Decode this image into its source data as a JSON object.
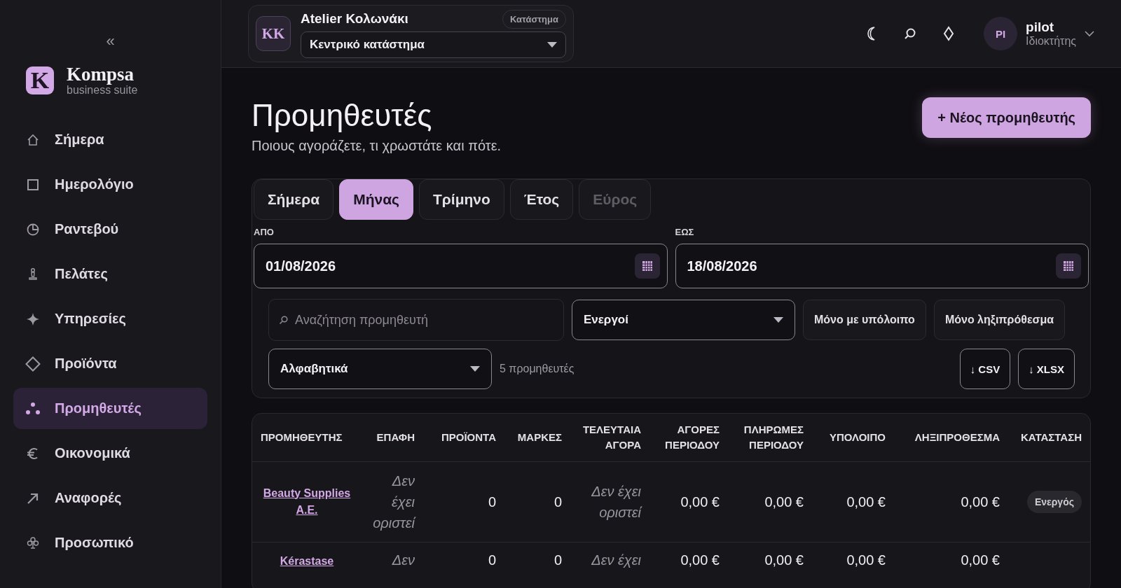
{
  "sidebar": {
    "collapse": "«",
    "brand": {
      "logo": "K",
      "name": "Kompsa",
      "tagline": "business suite"
    },
    "items": [
      {
        "label": "Σήμερα",
        "kind": "home",
        "selected": false
      },
      {
        "label": "Ημερολόγιο",
        "kind": "calendar",
        "selected": false
      },
      {
        "label": "Ραντεβού",
        "kind": "appointments",
        "selected": false
      },
      {
        "label": "Πελάτες",
        "kind": "clients",
        "selected": false
      },
      {
        "label": "Υπηρεσίες",
        "kind": "services",
        "selected": false
      },
      {
        "label": "Προϊόντα",
        "kind": "products",
        "selected": false
      },
      {
        "label": "Προμηθευτές",
        "kind": "suppliers",
        "selected": true
      },
      {
        "label": "Οικονομικά",
        "kind": "finance",
        "selected": false
      },
      {
        "label": "Αναφορές",
        "kind": "reports",
        "selected": false
      },
      {
        "label": "Προσωπικό",
        "kind": "staff",
        "selected": false
      }
    ]
  },
  "topbar": {
    "store": {
      "initials": "KK",
      "name": "Atelier Κολωνάκι",
      "badge": "Κατάστημα",
      "branch": "Κεντρικό κατάστημα"
    },
    "user": {
      "initials": "PI",
      "name": "pilot",
      "role": "Ιδιοκτήτης"
    }
  },
  "page": {
    "title": "Προμηθευτές",
    "subtitle": "Ποιους αγοράζετε, τι χρωστάτε και πότε.",
    "new_button": "+ Νέος προμηθευτής"
  },
  "filters": {
    "tabs": [
      {
        "label": "Σήμερα",
        "selected": false,
        "disabled": false
      },
      {
        "label": "Μήνας",
        "selected": true,
        "disabled": false
      },
      {
        "label": "Τρίμηνο",
        "selected": false,
        "disabled": false
      },
      {
        "label": "Έτος",
        "selected": false,
        "disabled": false
      },
      {
        "label": "Εύρος",
        "selected": false,
        "disabled": true
      }
    ],
    "from": {
      "label": "ΑΠΟ",
      "value": "01/08/2026"
    },
    "to": {
      "label": "ΕΩΣ",
      "value": "18/08/2026"
    },
    "search": {
      "placeholder": "Αναζήτηση προμηθευτή"
    },
    "status_select": "Ενεργοί",
    "toggles": [
      {
        "label": "Μόνο με υπόλοιπο",
        "on": false
      },
      {
        "label": "Μόνο ληξιπρόθεσμα",
        "on": false
      }
    ],
    "sort_select": "Αλφαβητικά",
    "count": "5 προμηθευτές",
    "exports": [
      "↓ CSV",
      "↓ XLSX"
    ]
  },
  "table": {
    "columns": [
      "ΠΡΟΜΗΘΕΥΤΗΣ",
      "ΕΠΑΦΗ",
      "ΠΡΟΪΟΝΤΑ",
      "ΜΑΡΚΕΣ",
      "ΤΕΛΕΥΤΑΙΑ ΑΓΟΡΑ",
      "ΑΓΟΡΕΣ ΠΕΡΙΟΔΟΥ",
      "ΠΛΗΡΩΜΕΣ ΠΕΡΙΟΔΟΥ",
      "ΥΠΟΛΟΙΠΟ",
      "ΛΗΞΙΠΡΟΘΕΣΜΑ",
      "ΚΑΤΑΣΤΑΣΗ"
    ],
    "rows": [
      {
        "supplier": "Beauty Supplies A.E.",
        "contact": "Δεν έχει οριστεί",
        "products": "0",
        "brands": "0",
        "last_purchase": "Δεν έχει οριστεί",
        "purchases": "0,00 €",
        "payments": "0,00 €",
        "balance": "0,00 €",
        "overdue": "0,00 €",
        "status": "Ενεργός"
      },
      {
        "supplier": "Kérastase",
        "contact": "Δεν",
        "products": "0",
        "brands": "0",
        "last_purchase": "Δεν έχει",
        "purchases": "0,00 €",
        "payments": "0,00 €",
        "balance": "0,00 €",
        "overdue": "0,00 €"
      }
    ]
  }
}
